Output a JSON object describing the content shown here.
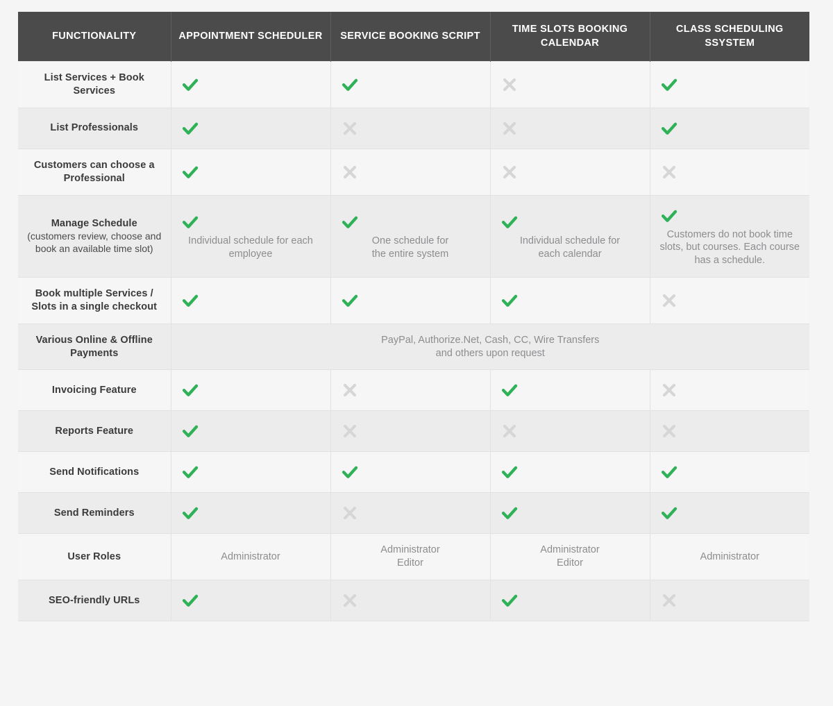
{
  "table": {
    "headers": [
      {
        "label": "FUNCTIONALITY"
      },
      {
        "label": "APPOINTMENT SCHEDULER"
      },
      {
        "label": "SERVICE BOOKING SCRIPT"
      },
      {
        "label": "TIME SLOTS BOOKING CALENDAR"
      },
      {
        "label": "CLASS SCHEDULING SSYSTEM"
      }
    ],
    "icons": {
      "check": "check-icon",
      "cross": "cross-icon"
    },
    "colors": {
      "header_background": "#4b4b4b",
      "header_text": "#ffffff",
      "check": "#2eb157",
      "cross": "#d6d6d6",
      "row_odd": "#f6f6f7",
      "row_even": "#ececed",
      "label_text": "#3b3b3b",
      "value_text": "#8d8d8f",
      "page_background": "#f5f5f5"
    },
    "rows": [
      {
        "label": "List Services + Book Services",
        "sublabel": "",
        "cells": [
          {
            "icon": "check",
            "note": ""
          },
          {
            "icon": "check",
            "note": ""
          },
          {
            "icon": "cross",
            "note": ""
          },
          {
            "icon": "check",
            "note": ""
          }
        ]
      },
      {
        "label": "List Professionals",
        "sublabel": "",
        "cells": [
          {
            "icon": "check",
            "note": ""
          },
          {
            "icon": "cross",
            "note": ""
          },
          {
            "icon": "cross",
            "note": ""
          },
          {
            "icon": "check",
            "note": ""
          }
        ]
      },
      {
        "label": "Customers can choose a Professional",
        "sublabel": "",
        "cells": [
          {
            "icon": "check",
            "note": ""
          },
          {
            "icon": "cross",
            "note": ""
          },
          {
            "icon": "cross",
            "note": ""
          },
          {
            "icon": "cross",
            "note": ""
          }
        ]
      },
      {
        "label": "Manage Schedule",
        "sublabel": "(customers review, choose and book an available time slot)",
        "cells": [
          {
            "icon": "check",
            "note": "Individual schedule for each employee"
          },
          {
            "icon": "check",
            "note": "One schedule for\nthe entire system"
          },
          {
            "icon": "check",
            "note": "Individual schedule for\neach calendar"
          },
          {
            "icon": "check",
            "note": "Customers do not book time slots, but courses. Each course has a schedule."
          }
        ]
      },
      {
        "label": "Book multiple Services / Slots in a single checkout",
        "sublabel": "",
        "cells": [
          {
            "icon": "check",
            "note": ""
          },
          {
            "icon": "check",
            "note": ""
          },
          {
            "icon": "check",
            "note": ""
          },
          {
            "icon": "cross",
            "note": ""
          }
        ]
      },
      {
        "label": "Various Online & Offline Payments",
        "sublabel": "",
        "merged": true,
        "merged_note": "PayPal, Authorize.Net, Cash, CC, Wire Transfers\nand others upon request"
      },
      {
        "label": "Invoicing Feature",
        "sublabel": "",
        "cells": [
          {
            "icon": "check",
            "note": ""
          },
          {
            "icon": "cross",
            "note": ""
          },
          {
            "icon": "check",
            "note": ""
          },
          {
            "icon": "cross",
            "note": ""
          }
        ]
      },
      {
        "label": "Reports Feature",
        "sublabel": "",
        "cells": [
          {
            "icon": "check",
            "note": ""
          },
          {
            "icon": "cross",
            "note": ""
          },
          {
            "icon": "cross",
            "note": ""
          },
          {
            "icon": "cross",
            "note": ""
          }
        ]
      },
      {
        "label": "Send Notifications",
        "sublabel": "",
        "cells": [
          {
            "icon": "check",
            "note": ""
          },
          {
            "icon": "check",
            "note": ""
          },
          {
            "icon": "check",
            "note": ""
          },
          {
            "icon": "check",
            "note": ""
          }
        ]
      },
      {
        "label": "Send Reminders",
        "sublabel": "",
        "cells": [
          {
            "icon": "check",
            "note": ""
          },
          {
            "icon": "cross",
            "note": ""
          },
          {
            "icon": "check",
            "note": ""
          },
          {
            "icon": "check",
            "note": ""
          }
        ]
      },
      {
        "label": "User Roles",
        "sublabel": "",
        "cells": [
          {
            "icon": "",
            "note": "Administrator"
          },
          {
            "icon": "",
            "note": "Administrator\nEditor"
          },
          {
            "icon": "",
            "note": "Administrator\nEditor"
          },
          {
            "icon": "",
            "note": "Administrator"
          }
        ]
      },
      {
        "label": "SEO-friendly URLs",
        "sublabel": "",
        "cells": [
          {
            "icon": "check",
            "note": ""
          },
          {
            "icon": "cross",
            "note": ""
          },
          {
            "icon": "check",
            "note": ""
          },
          {
            "icon": "cross",
            "note": ""
          }
        ]
      }
    ]
  }
}
